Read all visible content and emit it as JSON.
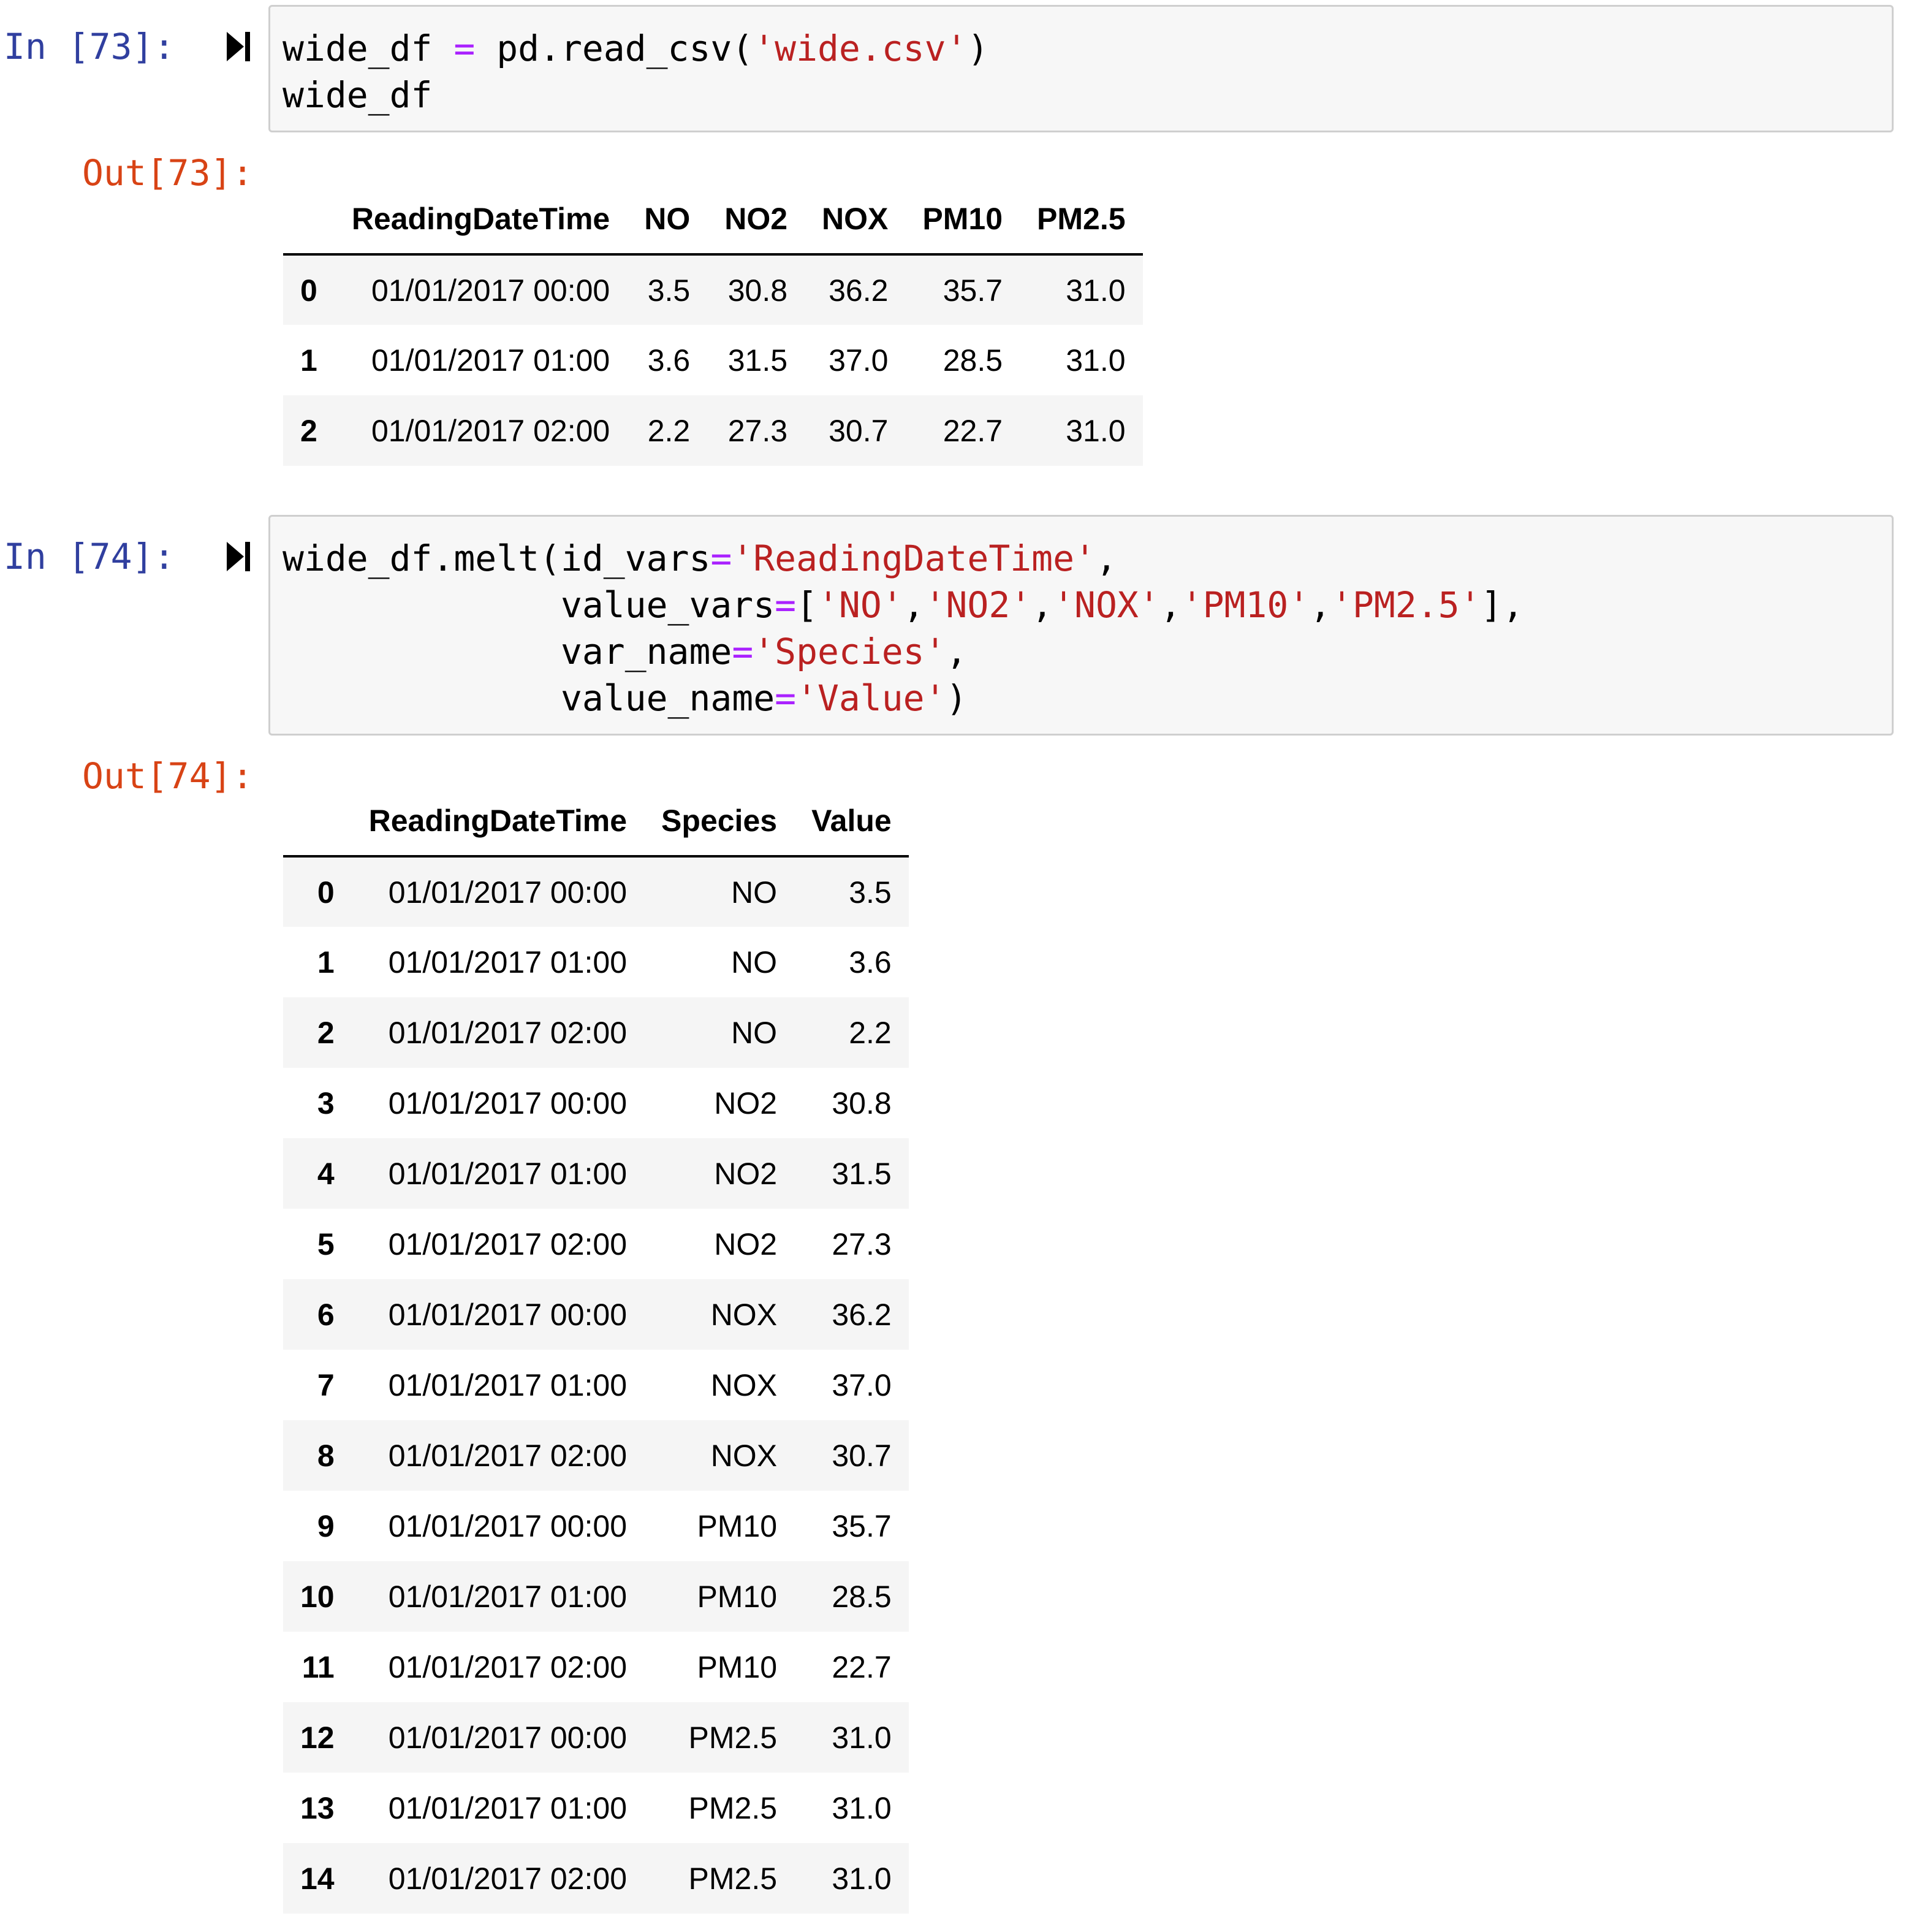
{
  "cells": [
    {
      "in_prompt": "In [73]:",
      "out_prompt": "Out[73]:",
      "code_lines": [
        [
          {
            "t": "wide_df "
          },
          {
            "t": "=",
            "c": "op"
          },
          {
            "t": " pd.read_csv("
          },
          {
            "t": "'wide.csv'",
            "c": "str"
          },
          {
            "t": ")"
          }
        ],
        [
          {
            "t": "wide_df"
          }
        ]
      ],
      "table": {
        "columns": [
          "",
          "ReadingDateTime",
          "NO",
          "NO2",
          "NOX",
          "PM10",
          "PM2.5"
        ],
        "rows": [
          [
            "0",
            "01/01/2017 00:00",
            "3.5",
            "30.8",
            "36.2",
            "35.7",
            "31.0"
          ],
          [
            "1",
            "01/01/2017 01:00",
            "3.6",
            "31.5",
            "37.0",
            "28.5",
            "31.0"
          ],
          [
            "2",
            "01/01/2017 02:00",
            "2.2",
            "27.3",
            "30.7",
            "22.7",
            "31.0"
          ]
        ]
      }
    },
    {
      "in_prompt": "In [74]:",
      "out_prompt": "Out[74]:",
      "code_lines": [
        [
          {
            "t": "wide_df.melt(id_vars"
          },
          {
            "t": "=",
            "c": "op"
          },
          {
            "t": "'ReadingDateTime'",
            "c": "str"
          },
          {
            "t": ","
          }
        ],
        [
          {
            "t": "             value_vars"
          },
          {
            "t": "=",
            "c": "op"
          },
          {
            "t": "["
          },
          {
            "t": "'NO'",
            "c": "str"
          },
          {
            "t": ","
          },
          {
            "t": "'NO2'",
            "c": "str"
          },
          {
            "t": ","
          },
          {
            "t": "'NOX'",
            "c": "str"
          },
          {
            "t": ","
          },
          {
            "t": "'PM10'",
            "c": "str"
          },
          {
            "t": ","
          },
          {
            "t": "'PM2.5'",
            "c": "str"
          },
          {
            "t": "],"
          }
        ],
        [
          {
            "t": "             var_name"
          },
          {
            "t": "=",
            "c": "op"
          },
          {
            "t": "'Species'",
            "c": "str"
          },
          {
            "t": ","
          }
        ],
        [
          {
            "t": "             value_name"
          },
          {
            "t": "=",
            "c": "op"
          },
          {
            "t": "'Value'",
            "c": "str"
          },
          {
            "t": ")"
          }
        ]
      ],
      "table": {
        "columns": [
          "",
          "ReadingDateTime",
          "Species",
          "Value"
        ],
        "rows": [
          [
            "0",
            "01/01/2017 00:00",
            "NO",
            "3.5"
          ],
          [
            "1",
            "01/01/2017 01:00",
            "NO",
            "3.6"
          ],
          [
            "2",
            "01/01/2017 02:00",
            "NO",
            "2.2"
          ],
          [
            "3",
            "01/01/2017 00:00",
            "NO2",
            "30.8"
          ],
          [
            "4",
            "01/01/2017 01:00",
            "NO2",
            "31.5"
          ],
          [
            "5",
            "01/01/2017 02:00",
            "NO2",
            "27.3"
          ],
          [
            "6",
            "01/01/2017 00:00",
            "NOX",
            "36.2"
          ],
          [
            "7",
            "01/01/2017 01:00",
            "NOX",
            "37.0"
          ],
          [
            "8",
            "01/01/2017 02:00",
            "NOX",
            "30.7"
          ],
          [
            "9",
            "01/01/2017 00:00",
            "PM10",
            "35.7"
          ],
          [
            "10",
            "01/01/2017 01:00",
            "PM10",
            "28.5"
          ],
          [
            "11",
            "01/01/2017 02:00",
            "PM10",
            "22.7"
          ],
          [
            "12",
            "01/01/2017 00:00",
            "PM2.5",
            "31.0"
          ],
          [
            "13",
            "01/01/2017 01:00",
            "PM2.5",
            "31.0"
          ],
          [
            "14",
            "01/01/2017 02:00",
            "PM2.5",
            "31.0"
          ]
        ]
      }
    }
  ],
  "icons": {
    "run": "run-cell-icon"
  },
  "colors": {
    "in_prompt": "#303f9f",
    "out_prompt": "#d84315",
    "code_string": "#ba2121",
    "code_operator": "#aa22ff",
    "cell_background": "#f7f7f7",
    "cell_border": "#cfcfcf",
    "row_stripe": "#f5f5f5"
  }
}
